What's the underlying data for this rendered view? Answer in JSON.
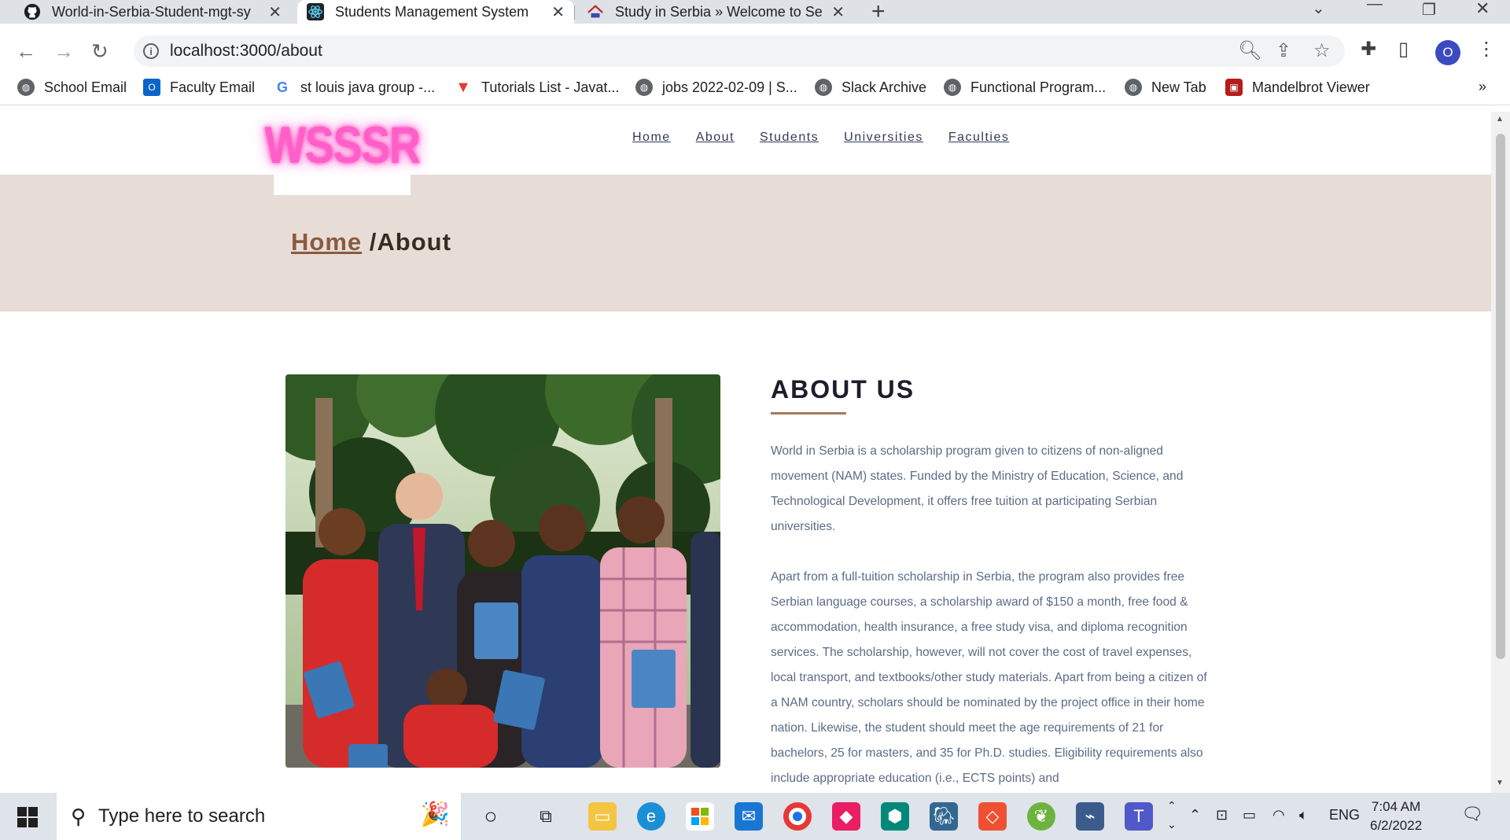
{
  "browser": {
    "tabs": [
      {
        "title": "World-in-Serbia-Student-mgt-sy",
        "icon": "github-icon"
      },
      {
        "title": "Students Management System",
        "icon": "react-icon"
      },
      {
        "title": "Study in Serbia » Welcome to Ser",
        "icon": "study-in-serbia-icon"
      }
    ],
    "url": "localhost:3000/about",
    "profile_initial": "O",
    "bookmarks": [
      "School Email",
      "Faculty Email",
      "st louis java group -...",
      "Tutorials List - Javat...",
      "jobs 2022-02-09 | S...",
      "Slack Archive",
      "Functional Program...",
      "New Tab",
      "Mandelbrot Viewer"
    ],
    "bookmarks_overflow": "»"
  },
  "site": {
    "logo": "WSSSR",
    "nav": [
      "Home",
      "About",
      "Students",
      "Universities",
      "Faculties"
    ],
    "breadcrumb": {
      "home": "Home",
      "current": "/About"
    },
    "about": {
      "title": "ABOUT US",
      "paragraph1": "World in Serbia is a scholarship program given to citizens of non-aligned movement (NAM) states. Funded by the Ministry of Education, Science, and Technological Development, it offers free tuition at participating Serbian universities.",
      "paragraph2": "Apart from a full-tuition scholarship in Serbia, the program also provides free Serbian language courses, a scholarship award of $150 a month, free food & accommodation, health insurance, a free study visa, and diploma recognition services. The scholarship, however, will not cover the cost of travel expenses, local transport, and textbooks/other study materials. Apart from being a citizen of a NAM country, scholars should be nominated by the project office in their home nation. Likewise, the student should meet the age requirements of 21 for bachelors, 25 for masters, and 35 for Ph.D. studies. Eligibility requirements also include appropriate education (i.e., ECTS points) and"
    }
  },
  "taskbar": {
    "search_placeholder": "Type here to search",
    "language": "ENG",
    "time": "7:04 AM",
    "date": "6/2/2022"
  },
  "colors": {
    "hero_bg": "#e8ddd6",
    "accent_line": "#a6795d",
    "body_text": "#5b6c86",
    "logo_pink": "#ff5fc8"
  }
}
